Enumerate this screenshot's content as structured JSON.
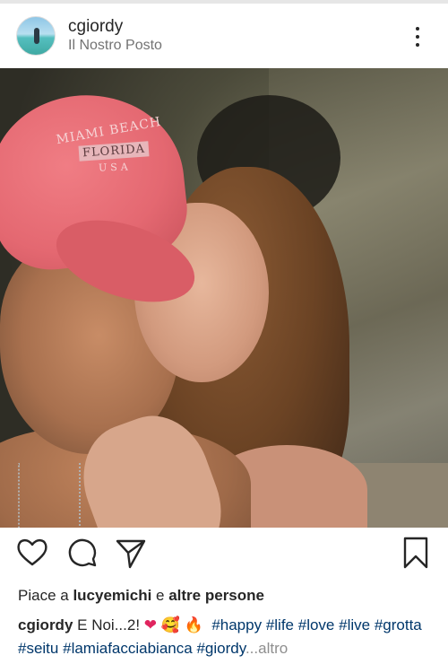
{
  "post": {
    "username": "cgiordy",
    "location": "Il Nostro Posto"
  },
  "photo": {
    "cap_line1": "MIAMI BEACH",
    "cap_line2": "FLORIDA",
    "cap_line3": "USA"
  },
  "actions": {
    "icons": [
      "heart-outline-icon",
      "comment-icon",
      "share-icon",
      "bookmark-icon"
    ]
  },
  "likes": {
    "prefix": "Piace a ",
    "user": "lucyemichi",
    "connector": " e ",
    "others": "altre persone"
  },
  "caption": {
    "username": "cgiordy",
    "text": "E Noi...2!",
    "emoji_heart": "❤",
    "emoji_face": "🥰",
    "emoji_fire": "🔥",
    "hashtags": [
      "#happy",
      "#life",
      "#love",
      "#live",
      "#grotta",
      "#seitu",
      "#lamiafacciabianca",
      "#giordy"
    ],
    "ellipsis": "...",
    "more": "altro"
  },
  "colors": {
    "text": "#262626",
    "secondary": "#737373",
    "hashtag": "#00376b",
    "heart": "#e0245e"
  }
}
